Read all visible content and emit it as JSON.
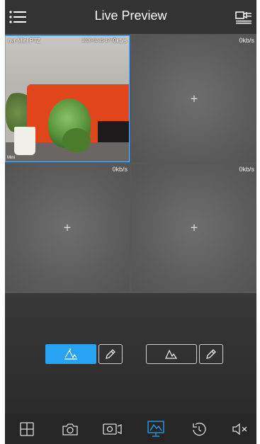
{
  "header": {
    "title": "Live Preview",
    "menu_icon": "menu-list-icon",
    "device_icon": "device-list-icon"
  },
  "grid": {
    "cells": [
      {
        "channel": "nvr-Mini PTZ",
        "timestamp": "2020-02-25 17:??",
        "rate": "0kb/s",
        "corner_text": "Mini",
        "live": true,
        "selected": true
      },
      {
        "rate": "0kb/s",
        "add": "+"
      },
      {
        "rate": "0kb/s",
        "add": "+"
      },
      {
        "rate": "0kb/s",
        "add": "+"
      }
    ]
  },
  "controls": {
    "line_icon": "line-rule-icon",
    "area_icon": "area-rule-icon",
    "edit_icon": "pencil-icon",
    "active_color": "#28a3f2"
  },
  "toolbar": {
    "items": [
      "layout-grid-icon",
      "snapshot-camera-icon",
      "record-video-icon",
      "smart-analysis-icon",
      "playback-icon",
      "audio-mute-icon"
    ],
    "active_index": 3
  }
}
